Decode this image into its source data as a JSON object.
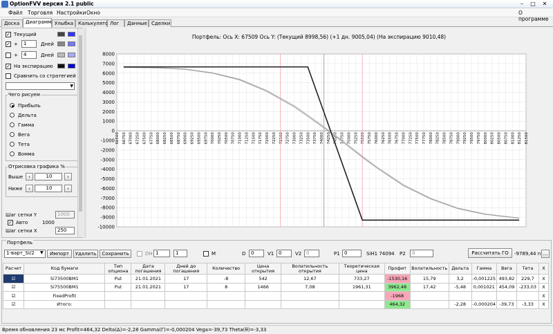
{
  "window": {
    "title": "OptionFVV версия 2.1 public",
    "min": "–",
    "max": "□",
    "close": "✕"
  },
  "menu": {
    "items": [
      "Файл",
      "Торговля",
      "Настройки",
      "Окно"
    ],
    "right": "О программе"
  },
  "tabs": [
    "Доска",
    "Диаграмма",
    "Улыбка",
    "Калькулятор",
    "Лог",
    "Данные",
    "Сделки"
  ],
  "active_tab": "Диаграмма",
  "left": {
    "current_label": "Текущий",
    "plus1_sign": "+",
    "plus1_value": "1",
    "plus1_unit": "Дней",
    "plus2_sign": "+",
    "plus2_value": "4",
    "plus2_unit": "Дней",
    "expiry_label": "На экспирацию",
    "compare_label": "Сравнить со стратегией",
    "draw_group": "Чего рисуем",
    "radios": [
      "Прибыль",
      "Дельта",
      "Гамма",
      "Вега",
      "Тета",
      "Вомма"
    ],
    "graph_group": "Отрисовка графика %",
    "above_label": "Выше",
    "above_value": "10",
    "below_label": "Ниже",
    "below_value": "10",
    "grid_y_label": "Шаг сетки Y",
    "grid_y_value": "1000",
    "auto_label": "Авто",
    "auto_value": "1000",
    "grid_x_label": "Шаг сетки X",
    "grid_x_value": "250",
    "colors": {
      "current": [
        "#444444",
        "#3333ff"
      ],
      "plus1": [
        "#888888",
        "#7777ff"
      ],
      "plus2": [
        "#bbbbbb",
        "#aaaaff"
      ],
      "expiry": [
        "#111111",
        "#0000cc"
      ]
    }
  },
  "chart_title": "Портфель: Ось X: 67509 Ось Y:  (Текущий 8998,56)  (+1 дн. 9005,04)  (На экспирацию 9010,48)",
  "chart_data": {
    "type": "line",
    "x_ticks_start": 66500,
    "x_tick_step": 250,
    "x_ticks_end": 81500,
    "ylim": [
      -10000,
      8000
    ],
    "y_tick_step": 1000,
    "grid": true,
    "vlines_red": [
      72500,
      75500
    ],
    "vline_gray": 74094,
    "series": [
      {
        "color": "#222222",
        "x": [
          66750,
          73500,
          75500,
          81250
        ],
        "y": [
          6650,
          6650,
          -9300,
          -9300
        ]
      },
      {
        "color": "#999999",
        "x": [
          66750,
          68000,
          69000,
          70000,
          71000,
          72000,
          73000,
          73500,
          74000,
          74500,
          75000,
          75500,
          76000,
          77000,
          78000,
          79000,
          80000,
          81250
        ],
        "y": [
          6600,
          6550,
          6400,
          6000,
          5300,
          4100,
          2500,
          1500,
          500,
          -550,
          -1650,
          -2750,
          -3800,
          -5700,
          -7100,
          -8100,
          -8700,
          -9100
        ]
      },
      {
        "color": "#bbbbbb",
        "x": [
          66750,
          68000,
          69000,
          70000,
          71000,
          72000,
          73000,
          73500,
          74000,
          74500,
          75000,
          75500,
          76000,
          77000,
          78000,
          79000,
          80000,
          81250
        ],
        "y": [
          6610,
          6570,
          6430,
          6050,
          5380,
          4200,
          2620,
          1630,
          620,
          -430,
          -1520,
          -2640,
          -3700,
          -5600,
          -7020,
          -8050,
          -8660,
          -9080
        ]
      }
    ]
  },
  "portfolio": {
    "group": "Портфель",
    "select": "1-варт_SI/2",
    "buttons": [
      "Импорт",
      "Удалить",
      "Сохранить"
    ],
    "dh_label": "DH",
    "dh_value": "1",
    "m_label": "M",
    "d_label": "D",
    "d_value": "0",
    "v1_label": "V1",
    "v1_value": "0",
    "v2_label": "V2",
    "v2_value": "0",
    "p1_label": "P1",
    "p1_value": "0",
    "sih_label": "SiH1 74094",
    "p2_label": "P2",
    "p2_value": "0",
    "calc_button": "Рассчитать ГО",
    "go_value": "-9789,44 п.",
    "more_button": "..."
  },
  "table": {
    "headers": [
      "Расчет",
      "Код бумаги",
      "Тип опциона",
      "Дата погашения",
      "Дней до погашения",
      "Количество",
      "Цена открытия",
      "Волатильность открытия",
      "Теоретическая цена",
      "Профит",
      "Волатильность",
      "Дельта",
      "Гамма",
      "Вега",
      "Тета",
      "X"
    ],
    "rows": [
      [
        "☑",
        "Si73500BM1",
        "Put",
        "21.01.2021",
        "17",
        "-8",
        "542",
        "12,67",
        "733,27",
        "-1530,16",
        "15,79",
        "3,2",
        "-0,001225",
        "493,82",
        "229,7",
        "X"
      ],
      [
        "☑",
        "Si75500BM1",
        "Put",
        "21.01.2021",
        "17",
        "8",
        "1466",
        "7,08",
        "1961,31",
        "3962,48",
        "17,42",
        "-5,48",
        "0,001021",
        "454,09",
        "-233,03",
        "X"
      ],
      [
        "☑",
        "FixedProfit",
        "",
        "",
        "",
        "",
        "",
        "",
        "",
        "-1968",
        "",
        "",
        "",
        "",
        "",
        "X"
      ],
      [
        "☑",
        "Итого:",
        "",
        "",
        "",
        "",
        "",
        "",
        "",
        "464,32",
        "",
        "-2,28",
        "-0,000204",
        "-39,73",
        "-3,33",
        "X"
      ]
    ]
  },
  "status": "Время обновления 23 мс  Profit=464,32 Delta(Δ)=-2,28 Gamma(Γ)=-0,000204 Vega=-39,73 Theta(θ)=-3,33"
}
